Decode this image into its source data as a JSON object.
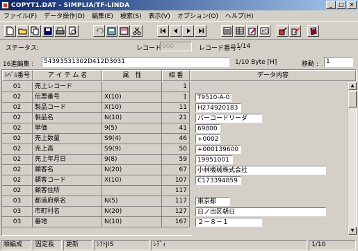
{
  "window": {
    "title": "COPYT1.DAT - SIMPLIA/TF-LINDA"
  },
  "menu": [
    "ファイル(F)",
    "データ操作(D)",
    "編集(E)",
    "検索(S)",
    "表示(V)",
    "オプション(O)",
    "ヘルプ(H)"
  ],
  "toolbar_icons": [
    "new-file-icon",
    "open-folder-icon",
    "copy-icon",
    "save-icon",
    "print-icon",
    "print-preview-icon",
    "undo-icon",
    "find-icon",
    "replace-icon",
    "cut-icon",
    "first-record-icon",
    "prev-record-icon",
    "next-record-icon",
    "last-record-icon",
    "list-view-icon",
    "table-view-icon",
    "edit-icon",
    "hex-view-icon",
    "tools-icon",
    "settings-icon",
    "help-book-icon"
  ],
  "status": {
    "status_label": "ステータス:",
    "status_value": "",
    "record_length_label": "レコード長 :",
    "record_length_value": "600",
    "record_no_label": "レコード番号 :",
    "record_no_value": "1/14"
  },
  "hex_edit": {
    "label": "16進編集 :",
    "value": "54393531302D412D3031",
    "byte_info": "1/10 Byte [H]",
    "move_label": "移動 :",
    "move_value": "1"
  },
  "grid": {
    "headers": {
      "level": "ﾚﾍﾞﾙ番号",
      "item_name": "ア イ テ ム 名",
      "attribute": "属　性",
      "relative": "相 番",
      "data": "データ内容"
    },
    "rows": [
      {
        "level": "01",
        "name": "売上レコード",
        "attr": "",
        "rel": "1",
        "data": ""
      },
      {
        "level": "02",
        "name": "伝票番号",
        "attr": "X(10)",
        "rel": "1",
        "data": "T9510-A-01"
      },
      {
        "level": "02",
        "name": "製品コード",
        "attr": "X(10)",
        "rel": "11",
        "data": "H274920183"
      },
      {
        "level": "02",
        "name": "製品名",
        "attr": "N(10)",
        "rel": "21",
        "data": "バーコードリーダ"
      },
      {
        "level": "02",
        "name": "単価",
        "attr": "9(5)",
        "rel": "41",
        "data": "69800"
      },
      {
        "level": "02",
        "name": "売上数量",
        "attr": "S9(4)",
        "rel": "46",
        "data": "+0002"
      },
      {
        "level": "02",
        "name": "売上高",
        "attr": "S9(9)",
        "rel": "50",
        "data": "+000139600"
      },
      {
        "level": "02",
        "name": "売上年月日",
        "attr": "9(8)",
        "rel": "59",
        "data": "19951001"
      },
      {
        "level": "02",
        "name": "顧客名",
        "attr": "N(20)",
        "rel": "67",
        "data": "小林機械株式会社"
      },
      {
        "level": "02",
        "name": "顧客コード",
        "attr": "X(10)",
        "rel": "107",
        "data": "C173394859"
      },
      {
        "level": "02",
        "name": "顧客住所",
        "attr": "",
        "rel": "117",
        "data": ""
      },
      {
        "level": "03",
        "name": "都道府県名",
        "attr": "N(5)",
        "rel": "117",
        "data": "東京都"
      },
      {
        "level": "03",
        "name": "市町村名",
        "attr": "N(20)",
        "rel": "127",
        "data": "日ノ出区朝日"
      },
      {
        "level": "03",
        "name": "番地",
        "attr": "N(10)",
        "rel": "167",
        "data": "２－８－１"
      }
    ]
  },
  "statusbar": {
    "mode": "順編成",
    "length_type": "固定長",
    "state": "更新",
    "encoding": "ｼﾌﾄJIS",
    "ready": "ﾚﾃﾞｨ",
    "position": "1/10"
  }
}
